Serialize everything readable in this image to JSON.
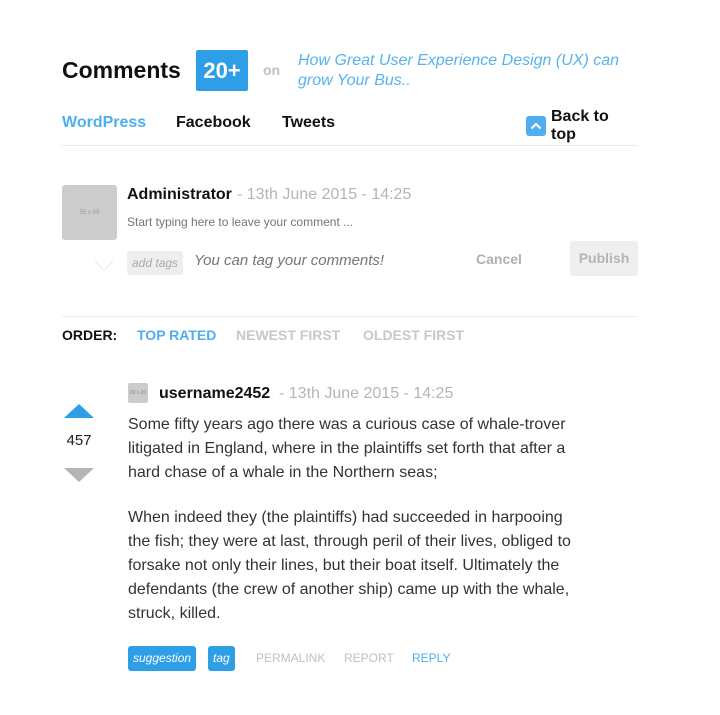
{
  "header": {
    "title": "Comments",
    "count": "20+",
    "on_label": "on",
    "article_title": "How Great User Experience Design (UX) can grow Your Bus.."
  },
  "tabs": [
    {
      "label": "WordPress",
      "active": true
    },
    {
      "label": "Facebook",
      "active": false
    },
    {
      "label": "Tweets",
      "active": false
    }
  ],
  "back_to_top": "Back to top",
  "compose": {
    "avatar_text": "55 x 55",
    "author": "Administrator",
    "date": "- 13th June 2015 - 14:25",
    "placeholder": "Start typing here to leave your comment ...",
    "add_tags_label": "add tags",
    "tag_placeholder": "You can tag your comments!",
    "cancel_label": "Cancel",
    "publish_label": "Publish"
  },
  "order": {
    "label": "ORDER:",
    "options": [
      {
        "label": "TOP RATED",
        "active": true
      },
      {
        "label": "NEWEST FIRST",
        "active": false
      },
      {
        "label": "OLDEST FIRST",
        "active": false
      }
    ]
  },
  "comment": {
    "votes": "457",
    "avatar_text": "20 x 20",
    "username": "username2452",
    "date": "- 13th June 2015 - 14:25",
    "paragraphs": [
      "Some fifty years ago there was a curious case of whale-trover litigated in England, where in the plaintiffs set forth that after a hard chase of a whale in the Northern seas;",
      "When indeed they (the plaintiffs) had succeeded in harpooing the fish; they were at last, through peril of their lives, obliged to forsake not only their lines, but their boat itself. Ultimately the defendants (the crew of another ship) came up with the whale, struck, killed."
    ],
    "tags": [
      "suggestion",
      "tag"
    ],
    "actions": {
      "permalink": "PERMALINK",
      "report": "REPORT",
      "reply": "REPLY"
    }
  },
  "colors": {
    "accent": "#2e9fe6",
    "link": "#4eaef0",
    "muted": "#b5b5b5"
  },
  "icons": {
    "back_to_top": "chevron-up-icon",
    "upvote": "arrow-up-icon",
    "downvote": "arrow-down-icon"
  }
}
